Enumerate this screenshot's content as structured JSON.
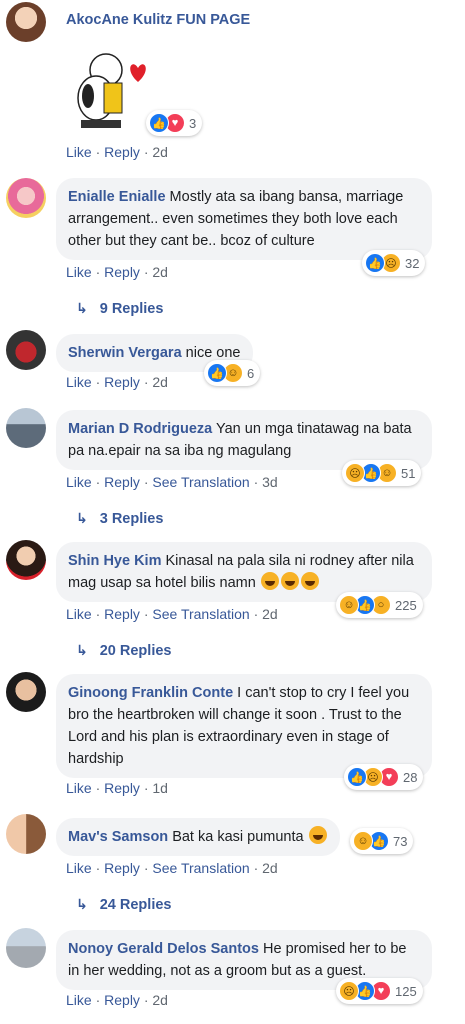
{
  "actions": {
    "like": "Like",
    "reply": "Reply",
    "see_translation": "See Translation",
    "sep": "·"
  },
  "comments": [
    {
      "author": "AkocAne Kulitz FUN PAGE",
      "text": "",
      "time": "2d",
      "reactions_count": "3"
    },
    {
      "author": "Enialle Enialle",
      "text": "Mostly ata sa ibang bansa, marriage arrangement.. even sometimes they both love each other but they cant be.. bcoz of culture",
      "time": "2d",
      "reactions_count": "32",
      "replies": "9 Replies"
    },
    {
      "author": "Sherwin Vergara",
      "text": "nice one",
      "time": "2d",
      "reactions_count": "6"
    },
    {
      "author": "Marian D Rodrigueza",
      "text": "Yan un mga tinatawag na bata pa na.epair na sa iba ng magulang",
      "time": "3d",
      "reactions_count": "51",
      "replies": "3 Replies"
    },
    {
      "author": "Shin Hye Kim",
      "text": "Kinasal na pala sila ni rodney after nila mag usap sa hotel bilis namn",
      "time": "2d",
      "reactions_count": "225",
      "replies": "20 Replies"
    },
    {
      "author": "Ginoong Franklin Conte",
      "text": "I can't stop to cry I feel you bro the heartbroken will change it soon . Trust to the Lord and his plan is extraordinary even in stage of hardship",
      "time": "1d",
      "reactions_count": "28"
    },
    {
      "author": "Mav's Samson",
      "text": "Bat ka kasi pumunta",
      "time": "2d",
      "reactions_count": "73",
      "replies": "24 Replies"
    },
    {
      "author": "Nonoy Gerald Delos Santos",
      "text": "He promised her to be in her wedding, not as a groom but as a guest.",
      "time": "2d",
      "reactions_count": "125"
    }
  ],
  "colors": {
    "link": "#385898",
    "bubble": "#f2f3f5",
    "like": "#1877f2",
    "love": "#f33e58",
    "face": "#f7b125"
  },
  "icons": [
    "like-icon",
    "love-icon",
    "sad-icon",
    "haha-icon",
    "wow-icon",
    "reply-arrow-icon"
  ]
}
